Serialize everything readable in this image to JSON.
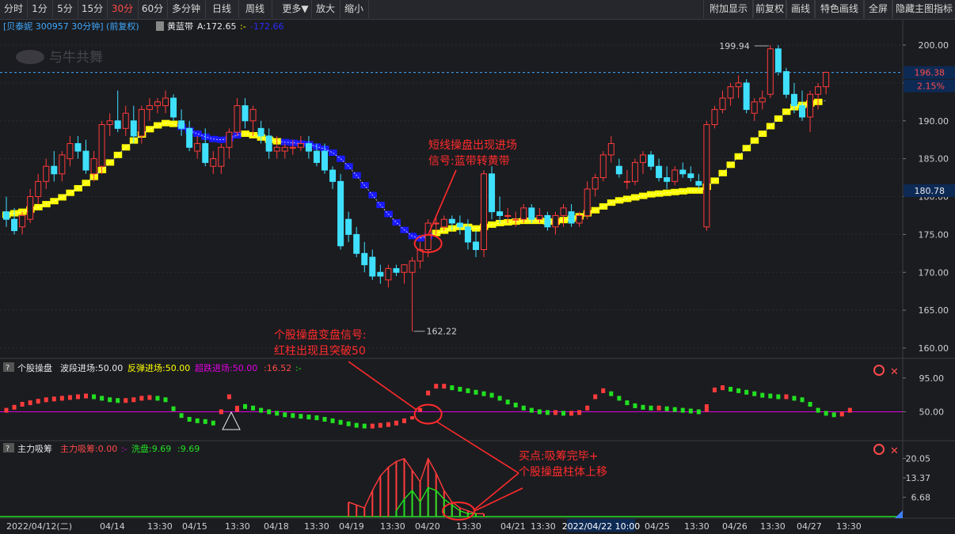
{
  "toolbar": {
    "left": [
      "分时",
      "1分",
      "5分",
      "15分",
      "30分",
      "60分",
      "多分钟",
      "日线",
      "周线",
      "更多▼",
      "放大",
      "缩小"
    ],
    "active": "30分",
    "right": [
      "附加显示",
      "前复权",
      "画线",
      "特色画线",
      "全屏",
      "隐藏主图指标"
    ]
  },
  "header": {
    "stock": "[贝泰妮 300957 30分钟] (前复权)",
    "indicator_name": "黄蓝带",
    "a_value": "A:172.65",
    "dash": ":-",
    "b_value": "-172.66"
  },
  "logo_text": "与牛共舞",
  "price_axis": {
    "ticks": [
      "200.00",
      "195.00",
      "190.00",
      "185.00",
      "180.00",
      "175.00",
      "170.00",
      "165.00",
      "160.00"
    ],
    "tick_values": [
      200,
      195,
      190,
      185,
      180,
      175,
      170,
      165,
      160
    ],
    "current_price": "196.38",
    "change_pct": "2.15%",
    "highlight_price": "180.78"
  },
  "price_annotations": {
    "high": "199.94",
    "low": "162.22"
  },
  "callouts": {
    "main_line1": "短线操盘出现进场",
    "main_line2": "信号:蓝带转黄带",
    "mid_line1": "个股操盘变盘信号:",
    "mid_line2": "红柱出现且突破50",
    "buy_line1": "买点:吸筹完毕+",
    "buy_line2": "个股操盘柱体上移"
  },
  "panel1": {
    "title": "个股操盘",
    "l1": "波段进场:50.00",
    "l2": "反弹进场:50.00",
    "l3": "超跌进场:50.00",
    "l4": ":16.52",
    "l5": ":-",
    "ticks": [
      "95.00",
      "50.00"
    ]
  },
  "panel2": {
    "title": "主力吸筹",
    "l1": "主力吸筹:0.00",
    "l2": ":-",
    "l3": "洗盘:9.69",
    "l4": ":9.69",
    "ticks": [
      "20.05",
      "13.37",
      "6.68"
    ]
  },
  "time_axis": {
    "labels": [
      "2022/04/12(二)",
      "04/14",
      "13:30",
      "04/15",
      "13:30",
      "04/18",
      "13:30",
      "04/19",
      "13:30",
      "04/20",
      "13:30",
      "04/21",
      "13:30",
      "2022/04/22 10:00",
      "04/25",
      "13:30",
      "04/26",
      "13:30",
      "04/27",
      "13:30"
    ]
  },
  "colors": {
    "up": "#ff3b3b",
    "down": "#3fe0ff",
    "band_up": "#ffff00",
    "band_down": "#1a1aff",
    "osc_line": "#e000e0",
    "osc_down": "#22e022"
  },
  "chart_data": {
    "type": "candlestick",
    "ylim": [
      160,
      201
    ],
    "candles": [
      [
        178,
        180,
        176,
        177
      ],
      [
        177,
        178.5,
        175,
        175.5
      ],
      [
        176,
        178,
        175,
        177.5
      ],
      [
        177,
        181,
        176.5,
        180
      ],
      [
        180,
        183,
        179,
        182
      ],
      [
        182,
        185,
        181,
        184
      ],
      [
        184,
        186,
        182,
        183
      ],
      [
        183,
        186,
        182,
        185.5
      ],
      [
        185,
        188,
        184,
        187
      ],
      [
        187,
        188,
        185,
        186
      ],
      [
        186,
        187.5,
        183,
        183.5
      ],
      [
        183,
        186,
        182,
        185
      ],
      [
        184,
        190,
        183,
        189.5
      ],
      [
        189.5,
        191,
        188,
        190
      ],
      [
        190,
        194,
        188.5,
        189
      ],
      [
        189,
        192,
        188,
        191
      ],
      [
        190,
        192,
        187,
        188
      ],
      [
        188,
        192,
        187,
        191.5
      ],
      [
        191.5,
        193,
        190,
        192
      ],
      [
        192,
        193,
        191,
        192.5
      ],
      [
        192,
        194,
        191,
        193
      ],
      [
        193,
        193.5,
        190,
        190.5
      ],
      [
        190,
        191.5,
        188,
        189
      ],
      [
        189,
        190,
        186,
        186.5
      ],
      [
        186,
        188,
        185,
        187
      ],
      [
        187,
        189,
        184,
        184.5
      ],
      [
        184,
        186,
        183,
        185
      ],
      [
        184,
        187,
        183,
        186.5
      ],
      [
        186.5,
        189,
        185,
        188.5
      ],
      [
        188.5,
        193,
        188,
        192
      ],
      [
        192,
        193,
        189,
        190
      ],
      [
        190,
        192,
        188,
        191.5
      ],
      [
        189,
        190,
        187,
        188
      ],
      [
        188,
        189,
        185,
        186
      ],
      [
        186,
        188,
        185,
        186.5
      ],
      [
        186,
        187,
        185,
        186.5
      ],
      [
        186.5,
        187.5,
        185.5,
        186.5
      ],
      [
        186.5,
        188,
        186,
        187
      ],
      [
        187,
        188,
        185,
        186
      ],
      [
        186,
        187,
        184,
        184.5
      ],
      [
        186,
        187,
        183,
        183.5
      ],
      [
        183.5,
        184,
        181,
        182
      ],
      [
        182,
        183,
        173,
        173.5
      ],
      [
        177,
        178,
        174,
        175
      ],
      [
        175,
        176,
        172,
        172.5
      ],
      [
        172.5,
        174,
        170,
        171
      ],
      [
        172,
        173,
        169,
        169.5
      ],
      [
        170,
        171,
        168.5,
        169.5
      ],
      [
        169,
        171,
        168,
        170.5
      ],
      [
        170.5,
        171,
        169.5,
        170
      ],
      [
        170,
        171,
        168.5,
        171
      ],
      [
        170,
        172,
        162.2,
        171.5
      ],
      [
        171.5,
        174,
        170.5,
        173
      ],
      [
        173,
        177,
        172,
        176.5
      ],
      [
        176.5,
        177.5,
        175,
        176.5
      ],
      [
        176,
        177.5,
        175.5,
        177
      ],
      [
        177,
        177.5,
        175.5,
        176.5
      ],
      [
        176.5,
        177.5,
        175,
        176
      ],
      [
        176,
        177,
        173,
        174
      ],
      [
        174,
        175.5,
        172,
        173
      ],
      [
        173,
        183.5,
        172,
        183
      ],
      [
        183,
        184,
        177,
        178
      ],
      [
        178,
        180,
        176.5,
        177.5
      ],
      [
        177.5,
        178.5,
        176.5,
        177.5
      ],
      [
        177,
        178,
        176,
        177
      ],
      [
        177,
        179,
        176.5,
        178.5
      ],
      [
        178.5,
        179,
        176.5,
        177
      ],
      [
        177,
        178.5,
        176.5,
        177.5
      ],
      [
        177.5,
        178,
        175.5,
        176
      ],
      [
        176,
        178,
        175,
        177.5
      ],
      [
        177.5,
        179,
        176,
        178.5
      ],
      [
        178,
        179,
        176,
        176.5
      ],
      [
        176.5,
        178,
        176,
        177.5
      ],
      [
        177.5,
        182,
        177,
        181
      ],
      [
        181,
        183,
        180,
        182.5
      ],
      [
        182.5,
        186,
        182,
        185.5
      ],
      [
        185.5,
        188,
        184.5,
        187
      ],
      [
        184,
        185,
        182.5,
        183
      ],
      [
        182,
        183.5,
        181,
        182
      ],
      [
        182,
        185,
        181.5,
        184.5
      ],
      [
        184.5,
        186,
        183,
        185.5
      ],
      [
        185.5,
        186,
        183.5,
        184
      ],
      [
        184,
        185,
        182,
        182.5
      ],
      [
        182.5,
        184,
        181,
        182
      ],
      [
        182,
        184,
        181.5,
        183.5
      ],
      [
        183.5,
        184.5,
        182.5,
        183
      ],
      [
        183,
        184,
        182,
        182.5
      ],
      [
        182,
        183,
        181,
        181.5
      ],
      [
        176,
        190,
        175.5,
        189.5
      ],
      [
        189.5,
        192,
        189,
        191.5
      ],
      [
        191.5,
        194,
        191,
        193
      ],
      [
        193,
        195,
        192,
        194.5
      ],
      [
        194.5,
        196,
        193,
        195
      ],
      [
        195,
        195.5,
        191,
        191.5
      ],
      [
        191,
        193,
        190,
        192.5
      ],
      [
        192.5,
        194,
        191.5,
        193
      ],
      [
        193.5,
        200,
        193,
        199.5
      ],
      [
        199.5,
        200,
        196,
        196.5
      ],
      [
        196.5,
        197,
        193,
        193.5
      ],
      [
        193.5,
        195,
        191,
        192
      ],
      [
        192,
        194,
        190,
        190.5
      ],
      [
        190.5,
        194,
        188.5,
        193.5
      ],
      [
        193.5,
        195,
        191.5,
        194.5
      ],
      [
        194.5,
        196.5,
        193.5,
        196.4
      ]
    ],
    "band": [
      177.6,
      177.8,
      178.0,
      178.3,
      178.6,
      179.0,
      179.4,
      179.9,
      180.5,
      181.1,
      181.8,
      182.6,
      183.5,
      184.5,
      185.5,
      186.5,
      187.4,
      188.2,
      188.9,
      189.4,
      189.7,
      189.6,
      189.2,
      188.7,
      188.3,
      187.9,
      187.6,
      187.5,
      187.7,
      188.1,
      188.3,
      188.1,
      187.8,
      187.5,
      187.3,
      187.2,
      187.1,
      187.0,
      186.9,
      186.6,
      186.3,
      185.8,
      185.0,
      184.0,
      182.8,
      181.5,
      180.2,
      178.9,
      177.7,
      176.6,
      175.6,
      174.8,
      174.5,
      174.8,
      175.2,
      175.5,
      175.8,
      176.0,
      176.0,
      175.8,
      176.0,
      176.3,
      176.5,
      176.6,
      176.7,
      176.8,
      176.8,
      176.8,
      176.7,
      176.7,
      176.9,
      177.1,
      177.4,
      177.8,
      178.2,
      178.7,
      179.2,
      179.5,
      179.7,
      179.9,
      180.1,
      180.3,
      180.4,
      180.5,
      180.6,
      180.7,
      180.8,
      180.8,
      181.3,
      182.1,
      183.1,
      184.2,
      185.3,
      186.4,
      187.4,
      188.3,
      189.3,
      190.3,
      191.2,
      191.8,
      192.1,
      192.3,
      192.5,
      192.7
    ],
    "band_dir": "yyyyyyyyyyyyyyyyyyyyyybbbbbbbbyyyyybbbbbbbbbbbbbbbbbbbyyyyyyyyyyyyyyyyyyyyyyyyyyyyyyyyyyyyyyyyyyyyyyyyyyyyy",
    "osc": [
      52,
      56,
      60,
      62,
      64,
      66,
      67,
      68,
      69,
      70,
      71,
      70,
      68,
      66,
      65,
      65,
      66,
      68,
      69,
      68,
      66,
      54,
      45,
      40,
      38,
      37,
      35,
      50,
      70,
      58,
      57,
      55,
      52,
      50,
      48,
      46,
      45,
      44,
      43,
      42,
      40,
      38,
      36,
      34,
      32,
      31,
      31,
      32,
      33,
      35,
      38,
      44,
      55,
      75,
      84,
      84,
      82,
      80,
      78,
      76,
      74,
      72,
      68,
      63,
      59,
      55,
      52,
      50,
      49,
      49,
      48,
      48,
      49,
      55,
      70,
      78,
      74,
      68,
      62,
      58,
      56,
      55,
      55,
      54,
      53,
      52,
      51,
      50,
      60,
      79,
      82,
      80,
      78,
      76,
      74,
      72,
      71,
      70,
      70,
      68,
      66,
      60,
      52,
      48,
      46,
      47,
      52
    ],
    "xichou": [
      0,
      0,
      0,
      0,
      0,
      0,
      0,
      0,
      0,
      0,
      0,
      0,
      0,
      0,
      0,
      0,
      0,
      0,
      0,
      0,
      0,
      0,
      0,
      0,
      0,
      0,
      0,
      0,
      0,
      0,
      0,
      0,
      0,
      0,
      0,
      0,
      0,
      0,
      0,
      0,
      0,
      0,
      0,
      5,
      4,
      3,
      9,
      14,
      17,
      19,
      20,
      16,
      12,
      20,
      15,
      9,
      5,
      3,
      2,
      1,
      1,
      0,
      0,
      0,
      0,
      0,
      0,
      0,
      0,
      0,
      0,
      0,
      0,
      0,
      0,
      0,
      0,
      0,
      0,
      0,
      0,
      0,
      0,
      0,
      0,
      0,
      0,
      0,
      0,
      0,
      0,
      0,
      0,
      0,
      0,
      0,
      0,
      0,
      0,
      0,
      0,
      0,
      0,
      0,
      0,
      0,
      0,
      0
    ],
    "xipan": [
      0,
      0,
      0,
      0,
      0,
      0,
      0,
      0,
      0,
      0,
      0,
      0,
      0,
      0,
      0,
      0,
      0,
      0,
      0,
      0,
      0,
      0,
      0,
      0,
      0,
      0,
      0,
      0,
      0,
      0,
      0,
      0,
      0,
      0,
      0,
      0,
      0,
      0,
      0,
      0,
      0,
      0,
      0,
      0,
      0,
      0,
      0,
      0,
      0,
      2,
      6,
      9,
      5,
      10,
      9,
      6,
      4,
      2,
      1,
      1,
      0,
      0,
      0,
      0,
      0,
      0,
      0,
      0,
      0,
      0,
      0,
      0,
      0,
      0,
      0,
      0,
      0,
      0,
      0,
      0,
      0,
      0,
      0,
      0,
      0,
      0,
      0,
      0,
      0,
      0,
      0,
      0,
      0,
      0,
      0,
      0,
      0,
      0,
      0,
      0,
      0,
      0,
      0,
      0,
      0,
      0,
      0,
      0
    ]
  }
}
